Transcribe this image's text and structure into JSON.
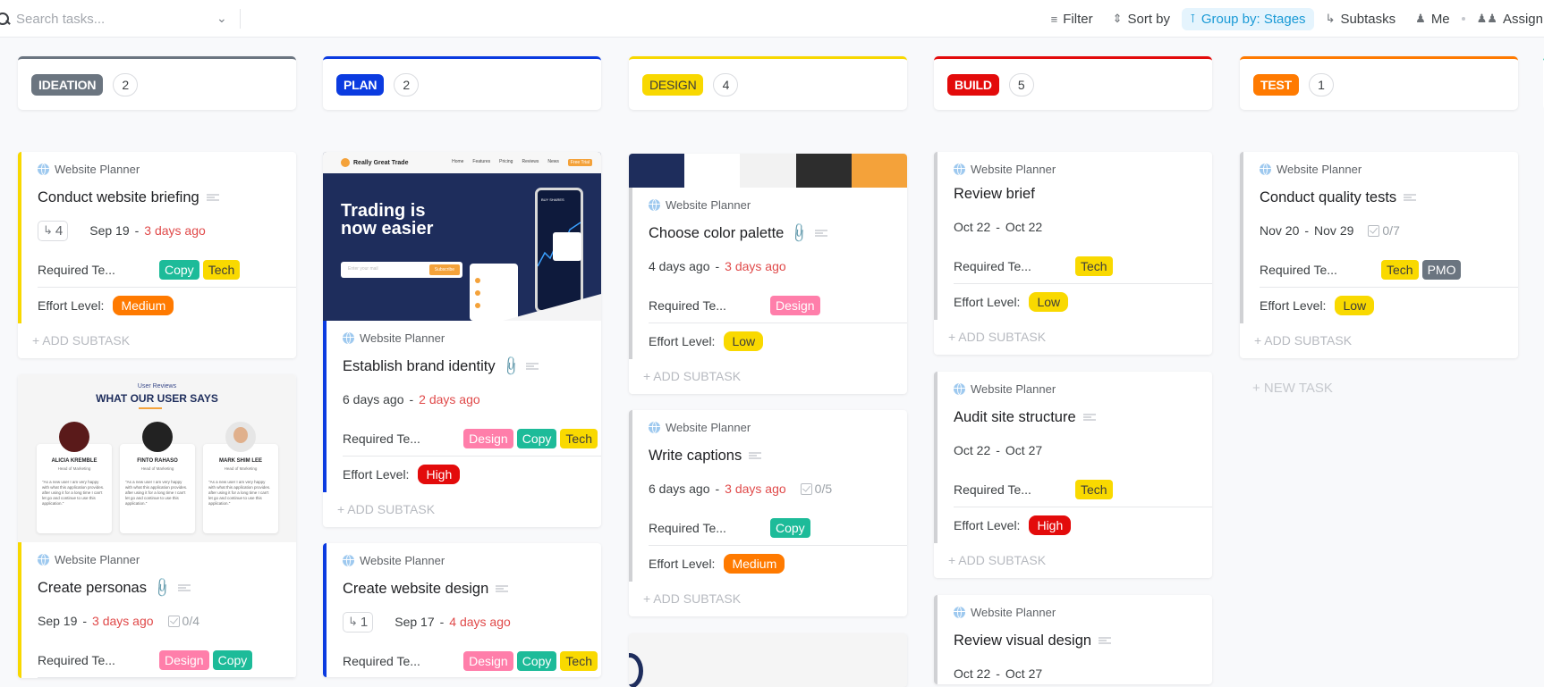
{
  "toolbar": {
    "search_placeholder": "Search tasks...",
    "filter": "Filter",
    "sort": "Sort by",
    "group": "Group by: Stages",
    "subtasks": "Subtasks",
    "me": "Me",
    "assignees": "Assign",
    "icons": {
      "filter": "filter-icon",
      "sort": "sort-icon",
      "group": "layers-icon",
      "subtasks": "subtasks-icon",
      "me": "user-icon",
      "assignees": "users-icon"
    }
  },
  "colors": {
    "ideation": "#6b7580",
    "plan": "#0b3be0",
    "design": "#f8d800",
    "build": "#e30b0b",
    "test": "#ff7a00",
    "copy": "#1dbb99",
    "tech": "#f9d900",
    "design_tag": "#ff7eaa",
    "pmo": "#6b7580",
    "medium": "#ff7a00",
    "high": "#e30b0b",
    "low": "#f9d900"
  },
  "columns": [
    {
      "stage": "IDEATION",
      "count": "2"
    },
    {
      "stage": "PLAN",
      "count": "2"
    },
    {
      "stage": "DESIGN",
      "count": "4"
    },
    {
      "stage": "BUILD",
      "count": "5"
    },
    {
      "stage": "TEST",
      "count": "1"
    }
  ],
  "common": {
    "project": "Website Planner",
    "required_label": "Required Te...",
    "effort_label": "Effort Level:",
    "add_subtask": "+ ADD SUBTASK",
    "new_task": "+ NEW TASK"
  },
  "cards": {
    "c1": {
      "title": "Conduct website briefing",
      "subtasks": "4",
      "start": "Sep 19",
      "end": "3 days ago",
      "tags": [
        "Copy",
        "Tech"
      ],
      "effort": "Medium"
    },
    "c2": {
      "title": "Create personas",
      "start": "Sep 19",
      "end": "3 days ago",
      "checklist": "0/4",
      "tags": [
        "Design",
        "Copy"
      ],
      "thumb": {
        "kicker": "User Reviews",
        "heading": "WHAT OUR USER SAYS",
        "people": [
          {
            "name": "ALICIA KREMBLE",
            "role": "Head of Marketing"
          },
          {
            "name": "FINTO RAHASO",
            "role": "Head of Marketing"
          },
          {
            "name": "MARK SHIM LEE",
            "role": "Head of Marketing"
          }
        ],
        "quote": "\"As a new user I am very happy with what this application provides. after using it for a long time I can't let go and continue to use this application.\""
      }
    },
    "p1": {
      "title": "Establish brand identity",
      "start": "6 days ago",
      "end": "2 days ago",
      "tags": [
        "Design",
        "Copy",
        "Tech"
      ],
      "effort": "High",
      "thumb": {
        "brand": "Really Great Trade",
        "nav": [
          "Home",
          "Features",
          "Pricing",
          "Reviews",
          "News"
        ],
        "cta": "Free Trial",
        "headline1": "Trading is",
        "headline2": "now easier",
        "email": "Enter your mail",
        "subscribe": "Subscribe",
        "phone_label": "BUY SHARES"
      }
    },
    "p2": {
      "title": "Create website design",
      "subtasks": "1",
      "start": "Sep 17",
      "end": "4 days ago",
      "tags": [
        "Design",
        "Copy",
        "Tech"
      ]
    },
    "d1": {
      "title": "Choose color palette",
      "start": "4 days ago",
      "end": "3 days ago",
      "tags": [
        "Design"
      ],
      "effort": "Low",
      "palette": [
        "#1e2d5c",
        "#ffffff",
        "#f2f2f2",
        "#2d2d2d",
        "#f4a23a"
      ]
    },
    "d2": {
      "title": "Write captions",
      "start": "6 days ago",
      "end": "3 days ago",
      "checklist": "0/5",
      "tags": [
        "Copy"
      ],
      "effort": "Medium"
    },
    "b1": {
      "title": "Review brief",
      "start": "Oct 22",
      "end": "Oct 22",
      "tags": [
        "Tech"
      ],
      "effort": "Low"
    },
    "b2": {
      "title": "Audit site structure",
      "start": "Oct 22",
      "end": "Oct 27",
      "tags": [
        "Tech"
      ],
      "effort": "High"
    },
    "b3": {
      "title": "Review visual design",
      "start": "Oct 22",
      "end": "Oct 27"
    },
    "t1": {
      "title": "Conduct quality tests",
      "start": "Nov 20",
      "end": "Nov 29",
      "checklist": "0/7",
      "tags": [
        "Tech",
        "PMO"
      ],
      "effort": "Low"
    }
  }
}
